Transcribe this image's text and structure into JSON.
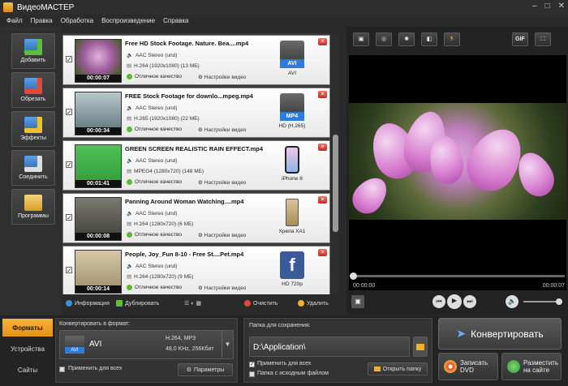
{
  "app": {
    "title": "ВидеоМАСТЕР",
    "window_controls": [
      "–",
      "□",
      "✕"
    ]
  },
  "menu": [
    "Файл",
    "Правка",
    "Обработка",
    "Воспроизведение",
    "Справка"
  ],
  "tools": [
    {
      "label": "Добавить",
      "icon": "add-film-icon",
      "color": "#3d7fc4"
    },
    {
      "label": "Обрезать",
      "icon": "cut-film-icon",
      "color": "#3d7fc4"
    },
    {
      "label": "Эффекты",
      "icon": "effects-icon",
      "color": "#3d7fc4"
    },
    {
      "label": "Соединить",
      "icon": "join-icon",
      "color": "#3d7fc4"
    },
    {
      "label": "Программы",
      "icon": "programs-icon",
      "color": "#e6b94a"
    }
  ],
  "files": [
    {
      "name": "Free HD Stock Footage. Nature. Bea....mp4",
      "audio": "AAC Stereo (und)",
      "video": "H.264 (1920x1080) (13 МБ)",
      "duration": "00:00:07",
      "quality": "Отличное качество",
      "settings": "Настройки видео",
      "device_label": "AVI",
      "device_badge": "AVI",
      "checked": "✓",
      "thumb_color": "#8a6a8a"
    },
    {
      "name": "FREE Stock Footage for downlo...mpeg.mp4",
      "audio": "AAC Stereo (und)",
      "video": "H.265 (1920x1080) (22 МБ)",
      "duration": "00:00:34",
      "quality": "Отличное качество",
      "settings": "Настройки видео",
      "device_label": "HD (H.265)",
      "device_badge": "MP4",
      "checked": "✓",
      "thumb_color": "#8fa3a8"
    },
    {
      "name": "GREEN SCREEN REALISTIC RAIN EFFECT.mp4",
      "audio": "AAC Stereo (und)",
      "video": "MPEG4 (1280x720) (148 МБ)",
      "duration": "00:01:41",
      "quality": "Отличное качество",
      "settings": "Настройки видео",
      "device_label": "iPhone 8",
      "device_badge": "",
      "checked": "✓",
      "thumb_color": "#3cb04a"
    },
    {
      "name": "Panning Around Woman Watching....mp4",
      "audio": "AAC Stereo (und)",
      "video": "H.264 (1280x720) (6 МБ)",
      "duration": "00:00:08",
      "quality": "Отличное качество",
      "settings": "Настройки видео",
      "device_label": "Xperia XA1",
      "device_badge": "",
      "checked": "✓",
      "thumb_color": "#5b5b55"
    },
    {
      "name": "People, Joy_Fun 8-10 - Free St....Pet.mp4",
      "audio": "AAC Stereo (und)",
      "video": "H.264 (1280x720) (9 МБ)",
      "duration": "00:00:14",
      "quality": "Отличное качество",
      "settings": "Настройки видео",
      "device_label": "HD 720p",
      "device_badge": "f",
      "checked": "✓",
      "thumb_color": "#b6a688"
    }
  ],
  "list_toolbar": {
    "info": "Информация",
    "duplicate": "Дублировать",
    "clear": "Очистить",
    "delete": "Удалить"
  },
  "player": {
    "time_current": "00:00:00",
    "time_total": "00:00:07",
    "progress": 0,
    "tools": [
      "▣",
      "◎",
      "✺",
      "◧",
      "🏃"
    ],
    "gif": "GIF",
    "fullscreen": "⛶"
  },
  "bottom_tabs": [
    "Форматы",
    "Устройства",
    "Сайты"
  ],
  "format": {
    "section_label": "Конвертировать в формат:",
    "name": "AVI",
    "badge": "AVI",
    "codec": "H.264, MP3",
    "audio": "48,0 KHz, 256Кбит",
    "apply_all": "Применить для всех",
    "params": "Параметры"
  },
  "save": {
    "section_label": "Папка для сохранения:",
    "path": "D:\\Application\\",
    "apply_all": "Применить для всех",
    "same_folder": "Папка с исходным файлом",
    "open": "Открыть папку"
  },
  "actions": {
    "convert": "Конвертировать",
    "dvd": "Записать DVD",
    "share": "Разместить на сайте"
  }
}
